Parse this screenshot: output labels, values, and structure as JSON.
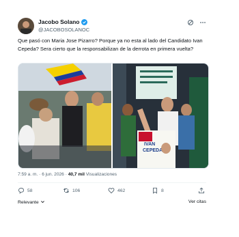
{
  "tweet": {
    "author_name": "Jacobo Solano",
    "handle": "@JACOBOSOLANOC",
    "text": "Que pasó con Maria Jose Pizarro? Porque ya no esta al lado del Candidato Ivan Cepeda? Sera cierto que la responsabilizan de la derrota en primera vuelta?",
    "time": "7:59 a. m.",
    "date": "6 jun. 2026",
    "views_count": "40,7 mil",
    "views_label": "Visualizaciones",
    "media_right_sign_line1": "IVAN",
    "media_right_sign_line2": "CEPEDA"
  },
  "actions": {
    "replies": "58",
    "reposts": "106",
    "likes": "462",
    "bookmarks": "8"
  },
  "footer": {
    "sort_label": "Relevante",
    "quotes_label": "Ver citas"
  },
  "icons": [
    "verified-badge-icon",
    "grok-icon",
    "more-icon",
    "reply-icon",
    "repost-icon",
    "like-icon",
    "bookmark-icon",
    "share-icon",
    "chevron-down-icon"
  ],
  "colors": {
    "verified": "#1d9bf0",
    "text": "#0f1419",
    "muted": "#536471"
  }
}
